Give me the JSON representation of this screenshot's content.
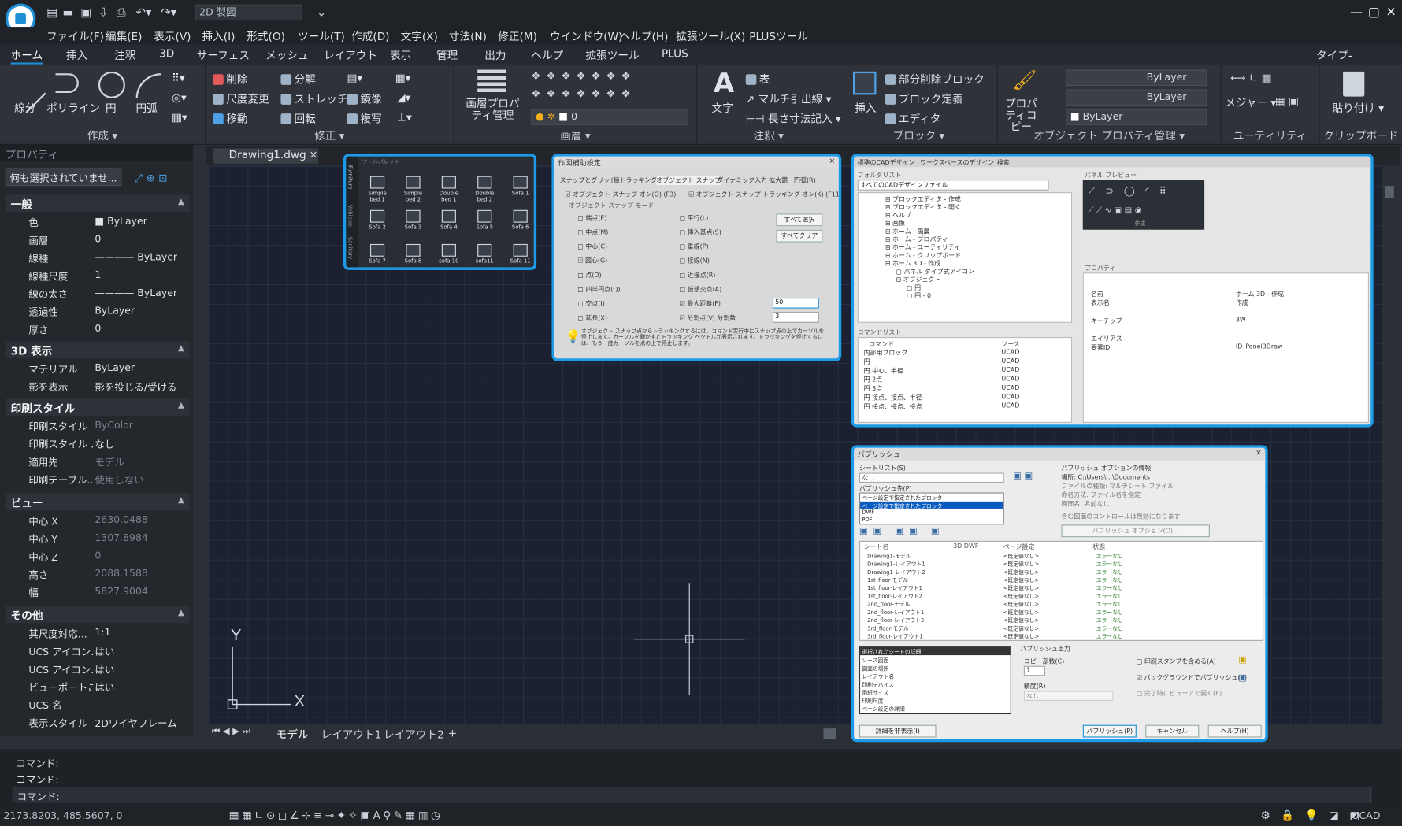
{
  "app": {
    "doc_name": "2D 製図",
    "tab_name": "Drawing1.dwg",
    "typing_label": "タイプ-",
    "status_app": "UCAD"
  },
  "menu": [
    "ファイル(F)",
    "編集(E)",
    "表示(V)",
    "挿入(I)",
    "形式(O)",
    "ツール(T)",
    "作成(D)",
    "文字(X)",
    "寸法(N)",
    "修正(M)",
    "ウインドウ(W)",
    "ヘルプ(H)",
    "拡張ツール(X)",
    "PLUSツール"
  ],
  "ribbon_tabs": [
    "ホーム",
    "挿入",
    "注釈",
    "3D",
    "サーフェス",
    "メッシュ",
    "レイアウト",
    "表示",
    "管理",
    "出力",
    "ヘルプ",
    "拡張ツール",
    "PLUS"
  ],
  "panels": {
    "draw": {
      "title": "作成",
      "line": "線分",
      "polyline": "ポリライン",
      "circle": "円",
      "arc": "円弧"
    },
    "modify": {
      "title": "修正",
      "delete": "削除",
      "explode": "分解",
      "scale": "尺度変更",
      "stretch": "ストレッチ",
      "mirror": "鏡像",
      "move": "移動",
      "rotate": "回転",
      "copy": "複写"
    },
    "layer": {
      "title": "画層",
      "manager": "画層プロパティ管理",
      "current": "0"
    },
    "annotation": {
      "title": "注釈",
      "text": "文字",
      "table": "表",
      "multileader": "マルチ引出線",
      "dim": "長さ寸法記入"
    },
    "block": {
      "title": "ブロック",
      "insert": "挿入",
      "partial": "部分削除ブロック",
      "define": "ブロック定義",
      "editor": "エディタ"
    },
    "props": {
      "title": "オブジェクト プロパティ管理",
      "copy": "プロパティコピー",
      "color": "ByLayer",
      "linetype": "ByLayer",
      "lineweight": "ByLayer"
    },
    "util": {
      "title": "ユーティリティ",
      "measure": "メジャー"
    },
    "clip": {
      "title": "クリップボード",
      "paste": "貼り付け"
    }
  },
  "properties": {
    "title": "プロパティ",
    "selection": "何も選択されていませ...",
    "sections": [
      {
        "name": "一般",
        "rows": [
          [
            "色",
            "ByLayer"
          ],
          [
            "画層",
            "0"
          ],
          [
            "線種",
            "———— ByLayer"
          ],
          [
            "線種尺度",
            "1"
          ],
          [
            "線の太さ",
            "———— ByLayer"
          ],
          [
            "透過性",
            "ByLayer"
          ],
          [
            "厚さ",
            "0"
          ]
        ]
      },
      {
        "name": "3D 表示",
        "rows": [
          [
            "マテリアル",
            "ByLayer"
          ],
          [
            "影を表示",
            "影を投じる/受ける"
          ]
        ]
      },
      {
        "name": "印刷スタイル",
        "rows": [
          [
            "印刷スタイル",
            "ByColor"
          ],
          [
            "印刷スタイル ...",
            "なし"
          ],
          [
            "適用先",
            "モデル"
          ],
          [
            "印刷テーブル...",
            "使用しない"
          ]
        ]
      },
      {
        "name": "ビュー",
        "rows": [
          [
            "中心 X",
            "2630.0488"
          ],
          [
            "中心 Y",
            "1307.8984"
          ],
          [
            "中心 Z",
            "0"
          ],
          [
            "高さ",
            "2088.1588"
          ],
          [
            "幅",
            "5827.9004"
          ]
        ]
      },
      {
        "name": "その他",
        "rows": [
          [
            "其尺度対応...",
            "1:1"
          ],
          [
            "UCS アイコン...",
            "はい"
          ],
          [
            "UCS アイコン...",
            "はい"
          ],
          [
            "ビューポートご...",
            "はい"
          ],
          [
            "UCS 名",
            ""
          ],
          [
            "表示スタイル",
            "2Dワイヤフレーム"
          ]
        ]
      }
    ]
  },
  "layout_tabs": [
    "モデル",
    "レイアウト1",
    "レイアウト2",
    "+"
  ],
  "command_lines": [
    "コマンド:",
    "コマンド:",
    "コマンド:"
  ],
  "coords": "2173.8203, 485.5607, 0",
  "palette": {
    "title": "ツールパレット",
    "side_tabs": [
      "Furniture",
      "Vehicles",
      "Sanitary"
    ],
    "items": [
      "Simple bed 1",
      "Simple bed 2",
      "Double bed 1",
      "Double bed 2",
      "Sofa 1",
      "Sofa 2",
      "Sofa 3",
      "Sofa 4",
      "Sofa 5",
      "Sofa 6",
      "Sofa 7",
      "Sofa 8",
      "sofa 10",
      "sofa11",
      "Sofa 11"
    ]
  },
  "osnap": {
    "title": "作図補助設定",
    "tabs": [
      "スナップとグリッド",
      "極トラッキング",
      "オブジェクト スナップ",
      "ダイナミック入力",
      "拡大鏡",
      "円弧(R)"
    ],
    "on_label": "オブジェクト スナップ オン(O) (F3)",
    "track_label": "オブジェクト スナップ トラッキング オン(K) (F11)",
    "mode_label": "オブジェクト スナップ モード",
    "left_items": [
      "端点(E)",
      "中点(M)",
      "中心(C)",
      "図心(G)",
      "点(D)",
      "四半円点(Q)",
      "交点(I)",
      "延長(X)"
    ],
    "right_items": [
      "平行(L)",
      "挿入基点(S)",
      "垂線(P)",
      "接線(N)",
      "近接点(R)",
      "仮想交点(A)",
      "最大距離(F)",
      "分割点(V) 分割数"
    ],
    "select_all": "すべて選択",
    "clear_all": "すべてクリア",
    "dist_value": "50",
    "div_value": "3",
    "note": "オブジェクト スナップ点からトラッキングするには、コマンド実行中にスナップ点の上でカーソルを停止します。カーソルを動かすとトラッキング ベクトルが表示されます。トラッキングを停止するには、もう一度カーソルを点の上で停止します。"
  },
  "design": {
    "tabs": [
      "標準のCADデザイン",
      "ワークスペースのデザイン",
      "検索"
    ],
    "tree_title": "フォルダリスト",
    "tree_filter": "すべてのCADデザインファイル",
    "tree_items": [
      "ブロックエディタ - 作成",
      "ブロックエディタ - 開く",
      "ヘルプ",
      "画像",
      "ホーム - 画層",
      "ホーム - プロパティ",
      "ホーム - ユーティリティ",
      "ホーム - クリップボード",
      "ホーム 3D - 作成",
      "パネル タイプ式アイコン",
      "オブジェクト",
      "円",
      "円 - 0"
    ],
    "cmd_title": "コマンドリスト",
    "cmd_header": [
      "コマンド",
      "ソース"
    ],
    "cmd_items": [
      "内部用ブロック",
      "円",
      "円 中心、半径",
      "円 2点",
      "円 3点",
      "円 接点、接点、半径",
      "円 接点、接点、接点"
    ],
    "cmd_source": "UCAD",
    "preview_title": "パネル プレビュー",
    "preview_caption": "作成",
    "prop_title": "プロパティ",
    "prop_rows": [
      [
        "名前",
        "ホーム 3D - 作成"
      ],
      [
        "表示名",
        "作成"
      ],
      [
        "キーチップ",
        "3W"
      ],
      [
        "エイリアス",
        ""
      ],
      [
        "要素ID",
        "ID_Panel3Draw"
      ]
    ]
  },
  "publish": {
    "title": "パブリッシュ",
    "sheet_list_label": "シートリスト(S)",
    "sheet_list_value": "なし",
    "publish_to_label": "パブリッシュ先(P)",
    "publish_to_options": [
      "ページ設定で指定されたプロッタ",
      "ページ設定で指定されたプロッタ",
      "DWF",
      "PDF"
    ],
    "options_label": "パブリッシュ オプションの情報",
    "location": "場所: C:\\Users\\...\\Documents",
    "option_lines": [
      "ファイルの種類: マルチシート ファイル",
      "命名方法: ファイル名を指定",
      "図面名: 名前なし"
    ],
    "include_note": "含む図面のコントロールは無効になります",
    "options_button": "パブリッシュ オプション(O)...",
    "columns": [
      "シート名",
      "3D DWF",
      "ページ設定",
      "状態"
    ],
    "sheets": [
      "Drawing1-モデル",
      "Drawing1-レイアウト1",
      "Drawing1-レイアウト2",
      "1st_floor-モデル",
      "1st_floor-レイアウト1",
      "1st_floor-レイアウト2",
      "2nd_floor-モデル",
      "2nd_floor-レイアウト1",
      "2nd_floor-レイアウト2",
      "3rd_floor-モデル",
      "3rd_floor-レイアウト1"
    ],
    "page_setup": "<既定値なし>",
    "status": "エラーなし",
    "details_title": "選択されたシートの詳細",
    "details_rows": [
      "ソース図面",
      "図面の場所",
      "レイアウト名",
      "印刷デバイス",
      "用紙サイズ",
      "印刷尺度",
      "ページ設定の詳細"
    ],
    "output_title": "パブリッシュ出力",
    "copies_label": "コピー部数(C)",
    "copies_value": "1",
    "precision_label": "精度(R)",
    "precision_value": "なし",
    "check_stamp": "印刷スタンプを含める(A)",
    "check_bg": "バックグラウンドでパブリッシュ(B)",
    "check_open": "完了時にビューアで開く(E)",
    "hide_details": "詳細を非表示(I)",
    "publish_btn": "パブリッシュ(P)",
    "cancel_btn": "キャンセル",
    "help_btn": "ヘルプ(H)"
  },
  "colors": {
    "accent": "#1e9be8",
    "canvas": "#1b2130",
    "panel": "#24272c"
  }
}
